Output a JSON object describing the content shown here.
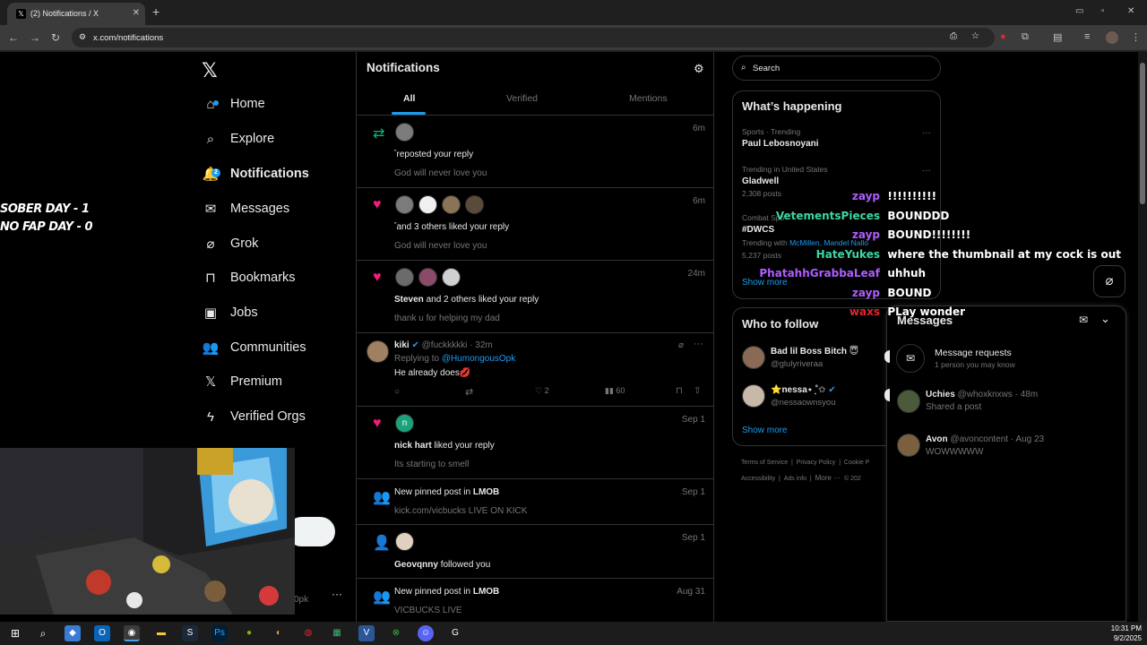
{
  "browser": {
    "tab_title": "(2) Notifications / X",
    "url": "x.com/notifications"
  },
  "sidebar": {
    "items": [
      {
        "label": "Home",
        "icon": "home-icon"
      },
      {
        "label": "Explore",
        "icon": "search-icon"
      },
      {
        "label": "Notifications",
        "icon": "bell-icon",
        "badge": "2"
      },
      {
        "label": "Messages",
        "icon": "mail-icon"
      },
      {
        "label": "Grok",
        "icon": "grok-icon"
      },
      {
        "label": "Bookmarks",
        "icon": "bookmark-icon"
      },
      {
        "label": "Jobs",
        "icon": "briefcase-icon"
      },
      {
        "label": "Communities",
        "icon": "people-icon"
      },
      {
        "label": "Premium",
        "icon": "x-icon"
      },
      {
        "label": "Verified Orgs",
        "icon": "lightning-icon"
      }
    ],
    "user_handle_fragment": "0pk"
  },
  "stream_overlay": {
    "line1": "SOBER DAY - 1",
    "line2": "NO FAP DAY - 0"
  },
  "main": {
    "title": "Notifications",
    "tabs": [
      "All",
      "Verified",
      "Mentions"
    ],
    "notifications": [
      {
        "type": "repost",
        "time": "6m",
        "text": "reposted your reply",
        "sub": "God will never love you",
        "dot": "\""
      },
      {
        "type": "like",
        "time": "6m",
        "text": "and 3 others liked your reply",
        "sub": "God will never love you",
        "dot": "\""
      },
      {
        "type": "like",
        "time": "24m",
        "name": "Steven",
        "text": "and 2 others liked your reply",
        "sub": "thank u for helping my dad"
      },
      {
        "type": "reply",
        "name": "kiki",
        "handle": "@fuckkkkki",
        "time": "32m",
        "replying_label": "Replying to",
        "replying_to": "@HumongousOpk",
        "body": "He already does💋",
        "likes": "2",
        "views": "60"
      },
      {
        "type": "like",
        "time": "Sep 1",
        "avatar_letter": "n",
        "name": "nick hart",
        "text": "liked your reply",
        "sub": "Its starting to smell"
      },
      {
        "type": "community",
        "time": "Sep 1",
        "text": "New pinned post in",
        "community": "LMOB",
        "sub": "kick.com/vicbucks LIVE ON KICK"
      },
      {
        "type": "follow",
        "time": "Sep 1",
        "name": "Geovqnny",
        "text": "followed you"
      },
      {
        "type": "community",
        "time": "Aug 31",
        "text": "New pinned post in",
        "community": "LMOB",
        "sub": "VICBUCKS LIVE"
      }
    ]
  },
  "right": {
    "search_placeholder": "Search",
    "happening_title": "What’s happening",
    "trends": [
      {
        "meta": "Sports · Trending",
        "name": "Paul Lebosnoyani"
      },
      {
        "meta": "Trending in United States",
        "name": "Gladwell",
        "posts": "2,308 posts"
      },
      {
        "meta": "Combat Spo",
        "name": "#DWCS",
        "with_label": "Trending with",
        "with": "McMillen, Mandel Nallo",
        "posts": "5,237 posts"
      }
    ],
    "show_more": "Show more",
    "follow_title": "Who to follow",
    "follow": [
      {
        "name": "Bad lil Boss Bitch 😇",
        "handle": "@glulyriveraa"
      },
      {
        "name": "⭐nessa⋆ ͙˚✩",
        "handle": "@nessaownsyou"
      }
    ],
    "footer": [
      "Terms of Service",
      "|",
      "Privacy Policy",
      "|",
      "Cookie P",
      "Accessibility",
      "|",
      "Ads info",
      "|",
      "More ···",
      "© 202"
    ]
  },
  "chat": [
    {
      "user": "zayp",
      "color": "#b05cff",
      "msg": "!!!!!!!!!!"
    },
    {
      "user": "VetementsPieces",
      "color": "#3cd6a3",
      "msg": "BOUNDDD"
    },
    {
      "user": "zayp",
      "color": "#b05cff",
      "msg": "BOUND!!!!!!!!"
    },
    {
      "user": "HateYukes",
      "color": "#3cd6a3",
      "msg": "where the thumbnail at my cock is out"
    },
    {
      "user": "PhatahhGrabbaLeaf",
      "color": "#b05cff",
      "msg": "uhhuh"
    },
    {
      "user": "zayp",
      "color": "#b05cff",
      "msg": "BOUND"
    },
    {
      "user": "waxs",
      "color": "#e0262d",
      "msg": "PLay wonder"
    }
  ],
  "messages": {
    "title": "Messages",
    "requests_title": "Message requests",
    "requests_sub": "1 person you may know",
    "threads": [
      {
        "name": "Uchies",
        "handle": "@whoxknxws",
        "time": "· 48m",
        "preview": "Shared a post"
      },
      {
        "name": "Avon",
        "handle": "@avoncontent",
        "time": "· Aug 23",
        "preview": "WOWWWWW"
      }
    ]
  },
  "taskbar": {
    "time": "10:31 PM",
    "date": "9/2/2025"
  },
  "colors": {
    "accent": "#1d9bf0",
    "like": "#f91880",
    "repost": "#00ba7c"
  }
}
